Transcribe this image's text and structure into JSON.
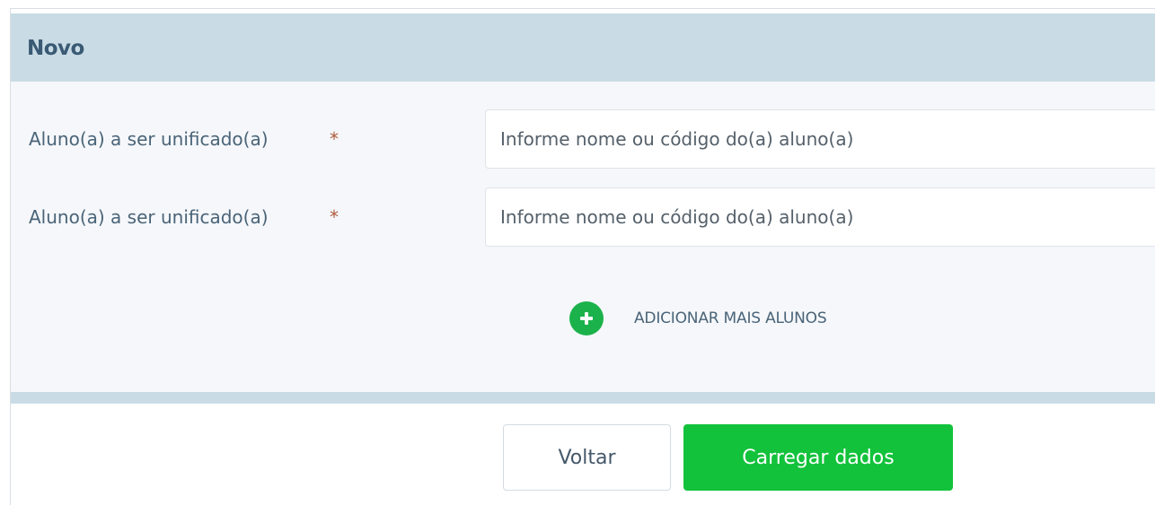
{
  "panel": {
    "title": "Novo"
  },
  "fields": [
    {
      "label": "Aluno(a) a ser unificado(a)",
      "required_mark": "*",
      "placeholder": "Informe nome ou código do(a) aluno(a)",
      "value": ""
    },
    {
      "label": "Aluno(a) a ser unificado(a)",
      "required_mark": "*",
      "placeholder": "Informe nome ou código do(a) aluno(a)",
      "value": ""
    }
  ],
  "add_more": {
    "icon": "plus-circle-icon",
    "label": "ADICIONAR MAIS ALUNOS"
  },
  "actions": {
    "back_label": "Voltar",
    "load_label": "Carregar dados"
  },
  "colors": {
    "header_bg": "#c9dce6",
    "panel_bg": "#f5f7fa",
    "accent_green": "#12c23b",
    "add_icon_green": "#1bb24b",
    "required_star": "#b05a3c"
  }
}
